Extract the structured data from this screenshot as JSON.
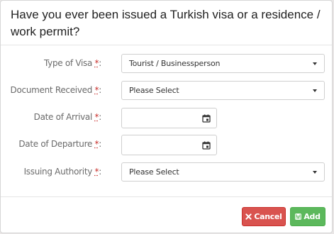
{
  "dialog": {
    "title": "Have you ever been issued a Turkish visa or a residence / work permit?"
  },
  "form": {
    "required_marker": "*",
    "type_of_visa": {
      "label": "Type of Visa",
      "value": "Tourist / Businessperson"
    },
    "document_received": {
      "label": "Document Received",
      "value": "Please Select"
    },
    "date_of_arrival": {
      "label": "Date of Arrival",
      "value": ""
    },
    "date_of_departure": {
      "label": "Date of Departure",
      "value": ""
    },
    "issuing_authority": {
      "label": "Issuing Authority",
      "value": "Please Select"
    }
  },
  "footer": {
    "cancel_label": "Cancel",
    "add_label": "Add"
  },
  "icons": {
    "calendar": "calendar-icon",
    "cancel": "times-icon",
    "add": "save-icon",
    "dropdown": "caret-down-icon"
  },
  "colors": {
    "cancel_button": "#d9534f",
    "add_button": "#5cb85c",
    "required": "#c9302c"
  }
}
